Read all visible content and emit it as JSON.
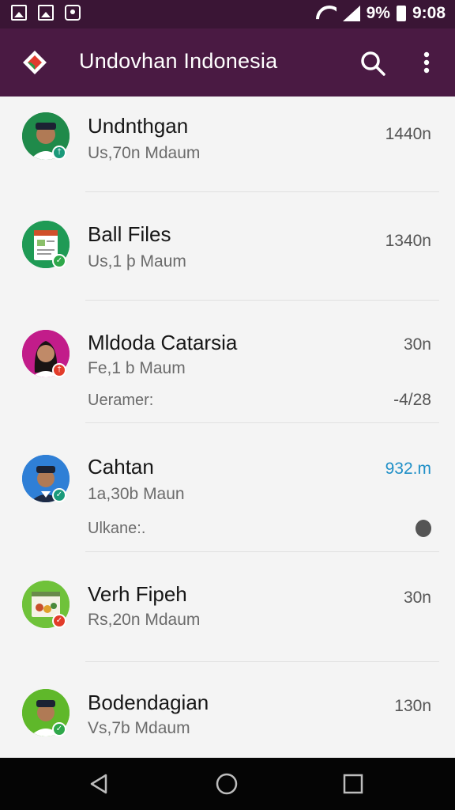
{
  "status_bar": {
    "battery_text": "9%",
    "time": "9:08",
    "icons": [
      "image-icon",
      "gallery-icon",
      "bag-icon",
      "wifi-icon",
      "signal-icon",
      "battery-icon"
    ]
  },
  "app_bar": {
    "title": "Undovhan Indonesia",
    "color": "#4a1a43",
    "icons": [
      "app-logo-icon",
      "search-icon",
      "more-vert-icon"
    ]
  },
  "chats": [
    {
      "name": "Undnthgan",
      "subtitle": "Us,70n Mdaum",
      "time": "1440n",
      "badge_color": "#1a9a7a"
    },
    {
      "name": "Ball Files",
      "subtitle": "Us,1 þ Maum",
      "time": "1340n",
      "badge_color": "#2fa84a"
    },
    {
      "name": "Mldoda Catarsia",
      "subtitle": "Fe,1 b Maum",
      "time": "30n",
      "extra_label": "Ueramer:",
      "extra_value": "-4/28",
      "badge_color": "#e23c2a"
    },
    {
      "name": "Cahtan",
      "subtitle": "1a,30b Maun",
      "time": "932.m",
      "time_accent": true,
      "extra_label": "Ulkane:.",
      "extra_icon": "lock-icon",
      "badge_color": "#1a9a7a"
    },
    {
      "name": "Verh Fipeh",
      "subtitle": "Rs,20n Mdaum",
      "time": "30n",
      "badge_color": "#e23c2a"
    },
    {
      "name": "Bodendagian",
      "subtitle": "Vs,7b Mdaum",
      "time": "130n",
      "badge_color": "#2fa84a"
    }
  ],
  "nav_bar": {
    "icons": [
      "back-icon",
      "home-icon",
      "recents-icon"
    ]
  }
}
